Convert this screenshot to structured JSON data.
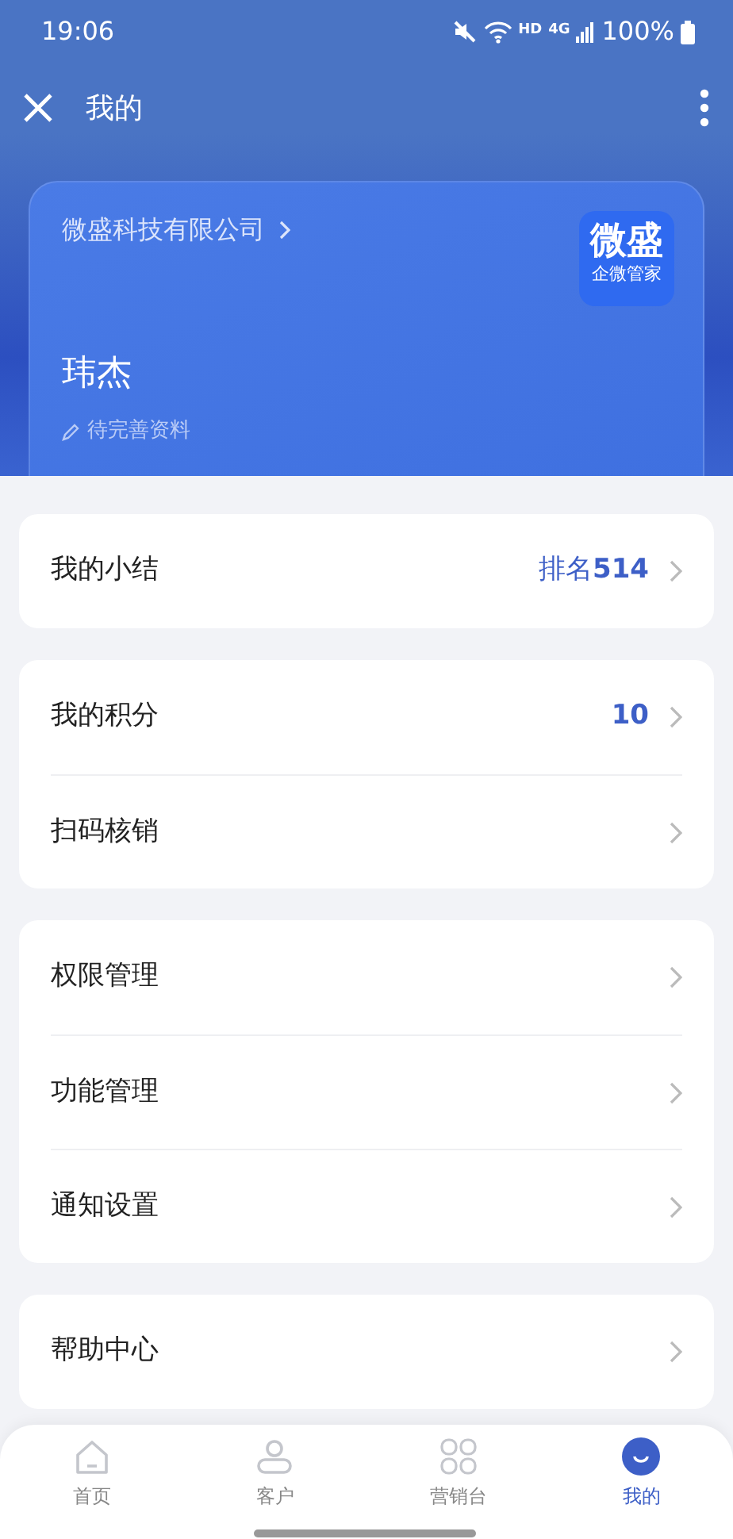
{
  "status_bar": {
    "time": "19:06",
    "network_label": "HD",
    "network_type": "4G",
    "battery": "100%"
  },
  "header": {
    "title": "我的"
  },
  "profile": {
    "company": "微盛科技有限公司",
    "name": "玮杰",
    "hint": "待完善资料",
    "logo_title": "微盛",
    "logo_subtitle": "企微管家"
  },
  "groups": [
    {
      "items": [
        {
          "label": "我的小结",
          "value": "排名**514**"
        }
      ]
    },
    {
      "items": [
        {
          "label": "我的积分",
          "value": "**10**"
        },
        {
          "label": "扫码核销"
        }
      ]
    },
    {
      "items": [
        {
          "label": "权限管理"
        },
        {
          "label": "功能管理"
        },
        {
          "label": "通知设置"
        }
      ]
    },
    {
      "items": [
        {
          "label": "帮助中心"
        }
      ]
    }
  ],
  "tabs": [
    {
      "label": "首页",
      "selected": false
    },
    {
      "label": "客户",
      "selected": false
    },
    {
      "label": "营销台",
      "selected": false
    },
    {
      "label": "我的",
      "selected": true
    }
  ]
}
